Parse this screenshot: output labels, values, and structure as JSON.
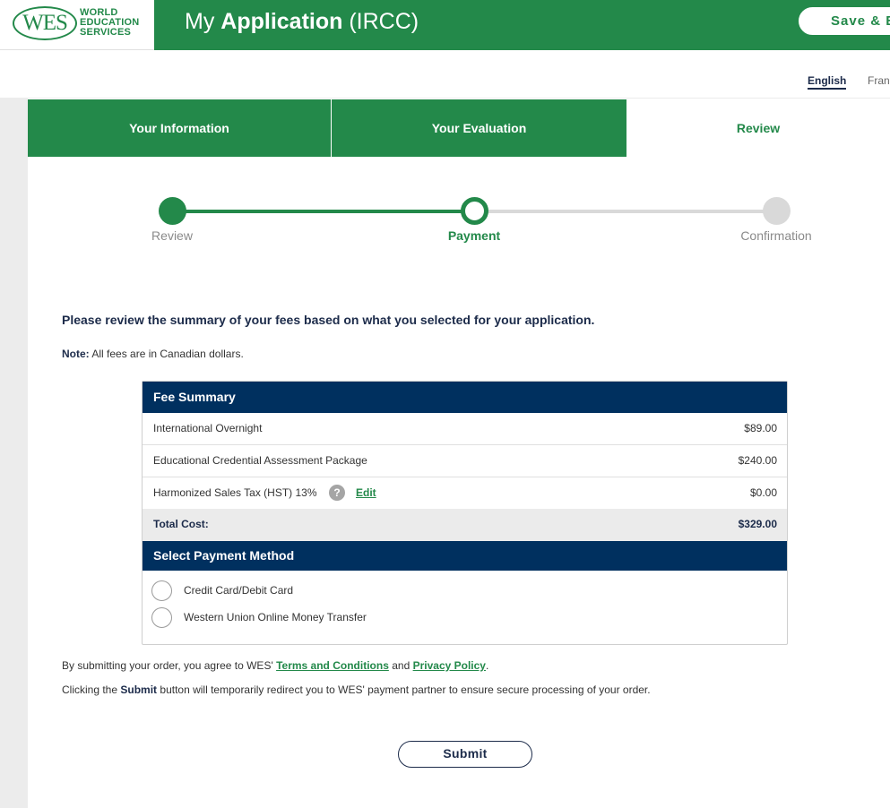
{
  "header": {
    "logo": {
      "mark": "WES",
      "line1": "WORLD",
      "line2": "EDUCATION",
      "line3": "SERVICES"
    },
    "title_prefix": "My",
    "title_bold": "Application",
    "title_suffix": "(IRCC)",
    "save_label": "Save & E"
  },
  "languages": {
    "english": "English",
    "french": "Fran"
  },
  "tabs": [
    {
      "label": "Your Information"
    },
    {
      "label": "Your Evaluation"
    },
    {
      "label": "Review"
    }
  ],
  "stepper": [
    {
      "label": "Review",
      "state": "complete"
    },
    {
      "label": "Payment",
      "state": "current"
    },
    {
      "label": "Confirmation",
      "state": "pending"
    }
  ],
  "intro": "Please review the summary of your fees based on what you selected for your application.",
  "note": {
    "prefix": "Note:",
    "text": "All fees are in Canadian dollars."
  },
  "fee_summary": {
    "title": "Fee Summary",
    "rows": [
      {
        "label": "International Overnight",
        "amount": "$89.00"
      },
      {
        "label": "Educational Credential Assessment Package",
        "amount": "$240.00"
      },
      {
        "label": "Harmonized Sales Tax (HST) 13%",
        "amount": "$0.00",
        "help_icon": "?",
        "edit_label": "Edit"
      }
    ],
    "total_label": "Total Cost:",
    "total_amount": "$329.00"
  },
  "payment": {
    "title": "Select Payment Method",
    "options": [
      {
        "label": "Credit Card/Debit Card",
        "selected": false
      },
      {
        "label": "Western Union Online Money Transfer",
        "selected": false
      }
    ]
  },
  "legal": {
    "line1_prefix": "By submitting your order, you agree to WES'",
    "terms_link": "Terms and Conditions",
    "and": "and",
    "privacy_link": "Privacy Policy",
    "period": ".",
    "line2_prefix": "Clicking the",
    "line2_bold": "Submit",
    "line2_suffix": "button will temporarily redirect you to WES' payment partner to ensure secure processing of your order."
  },
  "submit_label": "Submit",
  "colors": {
    "brand_green": "#23894a",
    "navy": "#00305f",
    "gray_rail": "#ececec"
  }
}
